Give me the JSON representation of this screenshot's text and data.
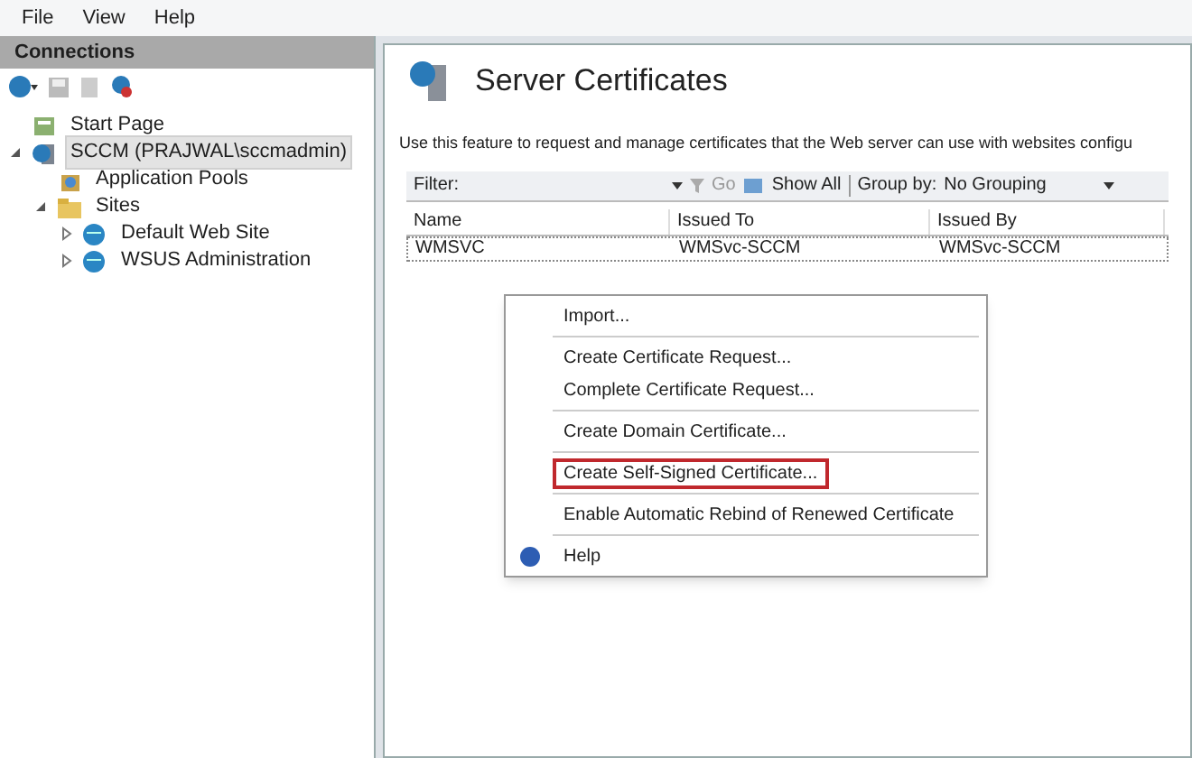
{
  "menu_bar": [
    "File",
    "View",
    "Help"
  ],
  "connections": {
    "title": "Connections",
    "tree": [
      {
        "label": "Start Page",
        "kind": "page",
        "selected": false
      },
      {
        "label": "SCCM (PRAJWAL\\sccmadmin)",
        "kind": "server",
        "selected": true,
        "expanded": true,
        "children": [
          {
            "label": "Application Pools",
            "kind": "pool",
            "selected": false
          },
          {
            "label": "Sites",
            "kind": "folder",
            "selected": false,
            "expanded": true,
            "children": [
              {
                "label": "Default Web Site",
                "kind": "globe",
                "selected": false,
                "expanded": false
              },
              {
                "label": "WSUS Administration",
                "kind": "globe",
                "selected": false,
                "expanded": false
              }
            ]
          }
        ]
      }
    ]
  },
  "feature": {
    "title": "Server Certificates",
    "description": "Use this feature to request and manage certificates that the Web server can use with websites configu",
    "filter": {
      "label": "Filter:",
      "go": "Go",
      "show_all": "Show All",
      "group_by_label": "Group by:",
      "group_by_value": "No Grouping"
    },
    "table": {
      "columns": [
        "Name",
        "Issued To",
        "Issued By"
      ],
      "rows": [
        [
          "WMSVC",
          "WMSvc-SCCM",
          "WMSvc-SCCM"
        ]
      ]
    }
  },
  "context_menu": [
    [
      {
        "label": "Import...",
        "annotated": false
      }
    ],
    [
      {
        "label": "Create Certificate Request...",
        "annotated": false
      },
      {
        "label": "Complete Certificate Request...",
        "annotated": false
      }
    ],
    [
      {
        "label": "Create Domain Certificate...",
        "annotated": false
      }
    ],
    [
      {
        "label": "Create Self-Signed Certificate...",
        "annotated": true
      }
    ],
    [
      {
        "label": "Enable Automatic Rebind of Renewed Certificate",
        "annotated": false
      }
    ],
    [
      {
        "label": "Help",
        "annotated": false,
        "kind": "help"
      }
    ]
  ]
}
